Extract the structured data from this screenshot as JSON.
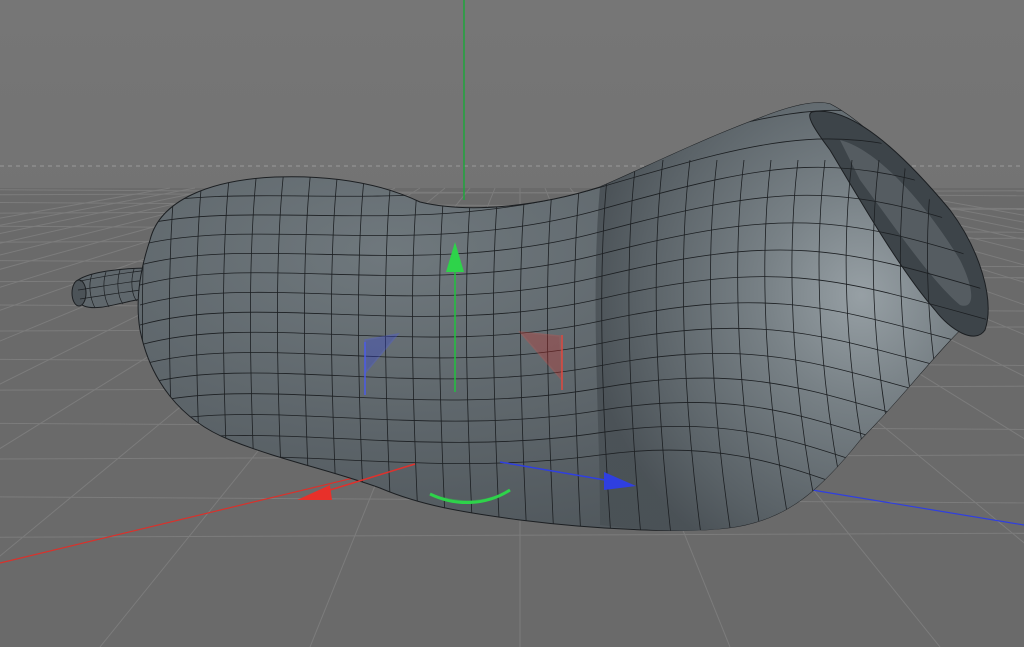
{
  "viewport": {
    "view": "perspective",
    "colors": {
      "sky": "#737373",
      "ground": "#6a6a6a",
      "grid_line": "#7d7d7d",
      "mesh_fill": "#6b7378",
      "mesh_highlight": "#9aa3a8",
      "mesh_wire": "#1c1f22",
      "axis_x": "#e0312c",
      "axis_y": "#2ed34a",
      "axis_z": "#2f3fe0"
    }
  },
  "scene": {
    "object": {
      "type": "polygon-mesh",
      "shape": "bent-tube",
      "selected": true
    },
    "gizmo": {
      "tool": "move",
      "handles": [
        "x",
        "y",
        "z"
      ]
    }
  }
}
